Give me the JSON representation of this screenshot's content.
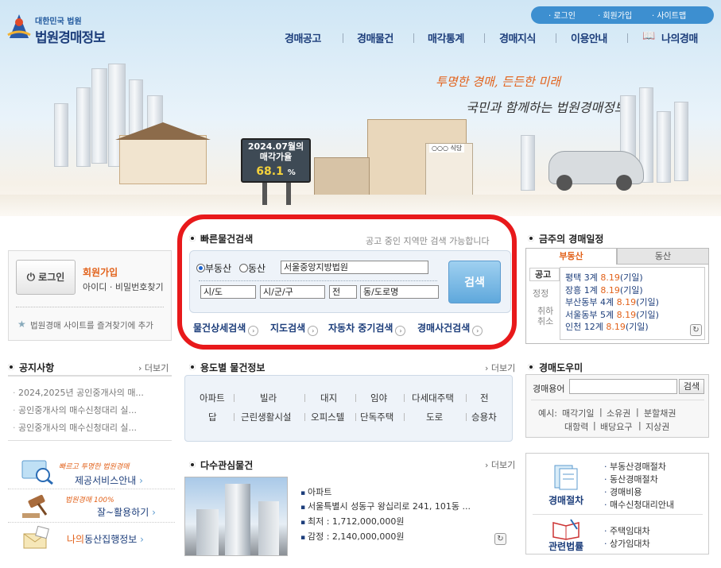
{
  "header": {
    "logo_sub": "대한민국 법원",
    "logo_main": "법원경매정보",
    "top_links": [
      "로그인",
      "회원가입",
      "사이트맵"
    ],
    "nav": [
      "경매공고",
      "경매물건",
      "매각통계",
      "경매지식",
      "이용안내",
      "나의경매"
    ]
  },
  "hero": {
    "slogan1": "투명한 경매, 든든한 미래",
    "slogan2": "국민과 함께하는 법원경매정보",
    "billboard_title": "2024.07월의\n매각가율",
    "billboard_value": "68.1",
    "billboard_unit": "%",
    "shop_sign": "○○○ 식당"
  },
  "login": {
    "button": "로그인",
    "signup": "회원가입",
    "find": "아이디 · 비밀번호찾기",
    "favorite": "법원경매 사이트를 즐겨찾기에 추가"
  },
  "quick_search": {
    "title": "빠른물건검색",
    "note": "공고 중인 지역만 검색 가능합니다",
    "radio_real": "부동산",
    "radio_movable": "동산",
    "court": "서울중앙지방법원",
    "sido": "시/도",
    "sigungu": "시/군/구",
    "jeon": "전",
    "dong": "동/도로명",
    "search_btn": "검색",
    "links": [
      "물건상세검색",
      "지도검색",
      "자동차 중기검색",
      "경매사건검색"
    ]
  },
  "weekly": {
    "title": "금주의 경매일정",
    "tabs": [
      "부동산",
      "동산"
    ],
    "side_labels": [
      "공고",
      "정정",
      "취하",
      "취소"
    ],
    "items": [
      {
        "court": "평택 3계",
        "date": "8.19",
        "tag": "(기일)"
      },
      {
        "court": "장흥 1계",
        "date": "8.19",
        "tag": "(기일)"
      },
      {
        "court": "부산동부 4계",
        "date": "8.19",
        "tag": "(기일)"
      },
      {
        "court": "서울동부 5계",
        "date": "8.19",
        "tag": "(기일)"
      },
      {
        "court": "인천 12계",
        "date": "8.19",
        "tag": "(기일)"
      }
    ]
  },
  "notices": {
    "title": "공지사항",
    "more": "더보기",
    "items": [
      "2024,2025년 공인중개사의 매...",
      "공인중개사의 매수신청대리 실...",
      "공인중개사의 매수신청대리 실..."
    ]
  },
  "usage": {
    "title": "용도별 물건정보",
    "more": "더보기",
    "row1": [
      "아파트",
      "빌라",
      "대지",
      "임야",
      "다세대주택",
      "전"
    ],
    "row2": [
      "답",
      "근린생활시설",
      "오피스텔",
      "단독주택",
      "도로",
      "승용차"
    ]
  },
  "helper": {
    "title": "경매도우미",
    "term_label": "경매용어",
    "search_btn": "검색",
    "example_label": "예시:",
    "examples": [
      "매각기일",
      "소유권",
      "분할채권",
      "대항력",
      "배당요구",
      "지상권"
    ]
  },
  "services": [
    {
      "tagline": "빠르고 투명한 법원경매",
      "label": "제공서비스안내"
    },
    {
      "tagline": "법원경매 100%",
      "label": "잘~활용하기"
    },
    {
      "tagline": "",
      "label_prefix": "나의",
      "label": "동산집행정보"
    }
  ],
  "popular": {
    "title": "다수관심물건",
    "more": "더보기",
    "type": "아파트",
    "address": "서울특별시 성동구 왕십리로 241, 101동 ...",
    "min_price": "최저 : 1,712,000,000원",
    "appraisal": "감정 : 2,140,000,000원"
  },
  "procedures": {
    "left_label1": "경매절차",
    "left_label2": "관련법률",
    "list1": [
      "부동산경매절차",
      "동산경매절차",
      "경매비용",
      "매수신청대리안내"
    ],
    "list2": [
      "주택임대차",
      "상가임대차"
    ]
  },
  "colors": {
    "accent": "#e2621b",
    "navy": "#1d3e7b",
    "highlight_ring": "#e8191b"
  }
}
